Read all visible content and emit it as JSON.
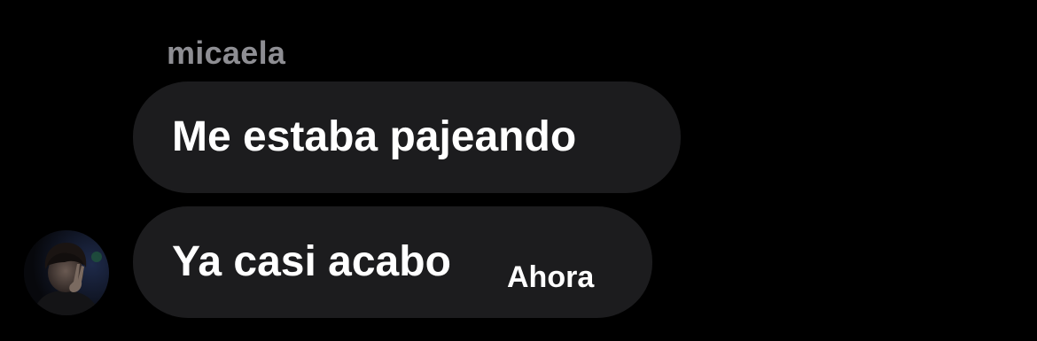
{
  "thread": {
    "sender_name": "micaela",
    "messages": [
      {
        "text": "Me estaba pajeando",
        "timestamp": ""
      },
      {
        "text": "Ya casi acabo",
        "timestamp": "Ahora"
      }
    ]
  },
  "icons": {
    "avatar": "user-avatar-photo"
  },
  "colors": {
    "background": "#000000",
    "bubble": "#1c1c1e",
    "sender_name": "#8e8e93",
    "text": "#ffffff"
  }
}
